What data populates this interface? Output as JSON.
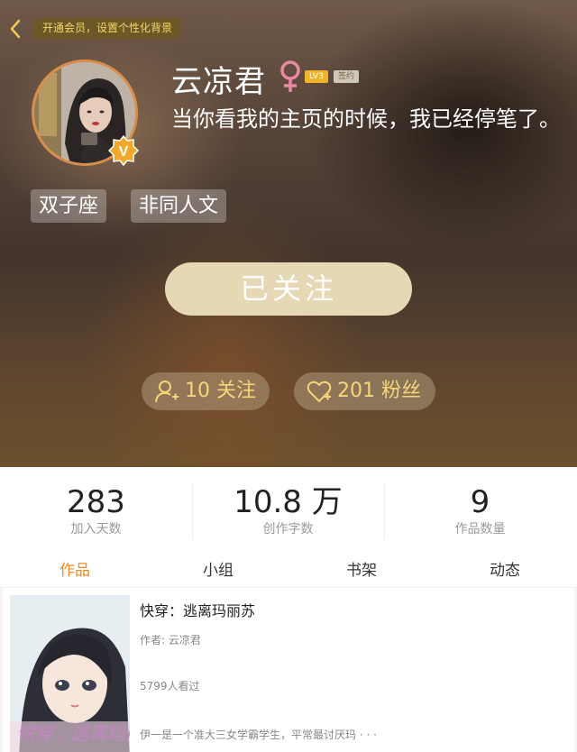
{
  "header": {
    "vip_banner": "开通会员，设置个性化背景",
    "username": "云凉君",
    "level_badge": "LV3",
    "sign_badge": "签约",
    "bio": "当你看我的主页的时候，我已经停笔了。",
    "tags": [
      "双子座",
      "非同人文"
    ],
    "follow_button": "已关注",
    "following_count": "10 关注",
    "fans_count": "201 粉丝",
    "avatar_badge": "V"
  },
  "stats": [
    {
      "value": "283",
      "label": "加入天数"
    },
    {
      "value": "10.8 万",
      "label": "创作字数"
    },
    {
      "value": "9",
      "label": "作品数量"
    }
  ],
  "tabs": [
    "作品",
    "小组",
    "书架",
    "动态"
  ],
  "active_tab": "作品",
  "book": {
    "title": "快穿：逃离玛丽苏",
    "author": "作者: 云凉君",
    "views": "5799人看过",
    "description": "伊一是一个准大三女学霸学生，平常最讨厌玛 · · ·",
    "cover_text": "快穿：逃离玛丽苏"
  },
  "colors": {
    "accent": "#f08a24",
    "gold": "#f6d57a",
    "follow_button": "#e6d7b5"
  },
  "icons": {
    "back": "chevron-left-icon",
    "gender": "female-icon",
    "following": "person-add-icon",
    "fans": "heart-icon"
  }
}
